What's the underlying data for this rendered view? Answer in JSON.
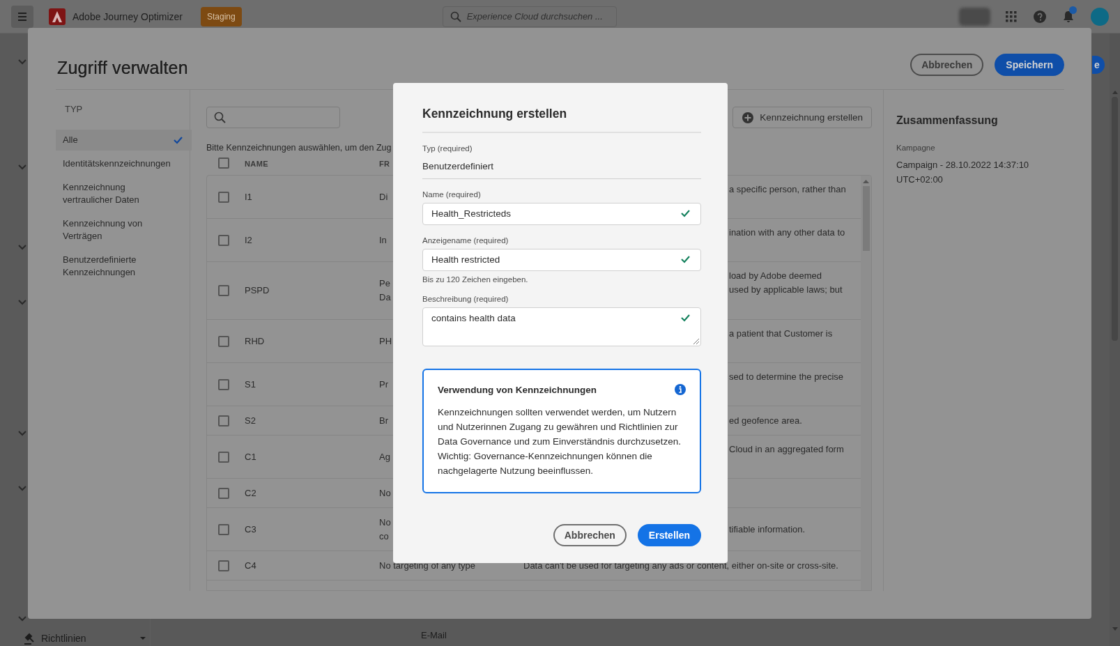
{
  "top_bar": {
    "app_name": "Adobe Journey Optimizer",
    "environment_badge": "Staging",
    "search": {
      "placeholder": "Experience Cloud durchsuchen ..."
    },
    "notifications_unread": true
  },
  "left_nav": {
    "items": [
      {
        "label": "Richtlinien"
      }
    ]
  },
  "background_page": {
    "text": "E-Mail",
    "action_button": "e"
  },
  "manage_access": {
    "title": "Zugriff verwalten",
    "buttons": [
      {
        "label": "Abbrechen",
        "kind": "secondary"
      },
      {
        "label": "Speichern",
        "kind": "primary"
      }
    ],
    "type_filter": {
      "heading": "TYP",
      "items": [
        {
          "label": "Alle",
          "selected": true
        },
        {
          "label": "Identitätskennzeichnungen",
          "selected": false
        },
        {
          "label": "Kennzeichnung vertraulicher Daten",
          "selected": false
        },
        {
          "label": "Kennzeichnung von Verträgen",
          "selected": false
        },
        {
          "label": "Benutzerdefinierte Kennzeichnungen",
          "selected": false
        }
      ]
    },
    "create_button": "Kennzeichnung erstellen",
    "instruction": "Bitte Kennzeichnungen auswählen, um den Zug",
    "table": {
      "columns": [
        "NAME",
        "FR"
      ],
      "select_all_checked": false,
      "rows": [
        {
          "checked": false,
          "name": "I1",
          "column_2": "Di",
          "column_3": "a specific person, rather than",
          "kind": "tall-top"
        },
        {
          "checked": false,
          "name": "I2",
          "column_2": "In",
          "column_3": "ination with any other data to",
          "kind": "tall-top"
        },
        {
          "checked": false,
          "name": "PSPD",
          "column_2": "Pe\nDa",
          "column_3": "load by Adobe deemed\nused by applicable laws; but",
          "kind": "taller-top"
        },
        {
          "checked": false,
          "name": "RHD",
          "column_2": "PH",
          "column_3": "a patient that Customer is",
          "kind": "tall-top"
        },
        {
          "checked": false,
          "name": "S1",
          "column_2": "Pr",
          "column_3": "sed to determine the precise",
          "kind": "tall-top"
        },
        {
          "checked": false,
          "name": "S2",
          "column_2": "Br",
          "column_3": "ed geofence area.",
          "kind": "short"
        },
        {
          "checked": false,
          "name": "C1",
          "column_2": "Ag",
          "column_3": "Cloud in an aggregated form",
          "kind": "tall-top"
        },
        {
          "checked": false,
          "name": "C2",
          "column_2": "No",
          "kind": "short"
        },
        {
          "checked": false,
          "name": "C3",
          "column_2": "No\nco",
          "column_3": "tifiable information.",
          "kind": "tall-mid"
        },
        {
          "checked": false,
          "name": "C4",
          "column_2": "No targeting of any type",
          "column_3": "Data can't be used for targeting any ads or content, either on-site or cross-site.",
          "kind": "open"
        }
      ]
    },
    "summary": {
      "title": "Zusammenfassung",
      "label": "Kampagne",
      "value": "Campaign - 28.10.2022 14:37:10 UTC+02:00"
    }
  },
  "dialog": {
    "title": "Kennzeichnung erstellen",
    "fields": [
      {
        "label": "Typ (required)",
        "value": "Benutzerdefiniert",
        "kind": "static"
      },
      {
        "label": "Name (required)",
        "value": "Health_Restricteds",
        "kind": "input",
        "valid": true
      },
      {
        "label": "Anzeigename (required)",
        "value": "Health restricted",
        "kind": "input",
        "valid": true,
        "hint": "Bis zu 120 Zeichen eingeben."
      },
      {
        "label": "Beschreibung (required)",
        "value": "contains health data",
        "kind": "textarea",
        "valid": true
      }
    ],
    "info": {
      "title": "Verwendung von Kennzeichnungen",
      "text": "Kennzeichnungen sollten verwendet werden, um Nutzern und Nutzerinnen Zugang zu gewähren und Richtlinien zur Data Governance und zum Einverständnis durchzusetzen. Wichtig: Governance-Kennzeichnungen können die nachgelagerte Nutzung beeinflussen."
    },
    "buttons": [
      {
        "label": "Abbrechen",
        "kind": "secondary"
      },
      {
        "label": "Erstellen",
        "kind": "primary"
      }
    ]
  }
}
